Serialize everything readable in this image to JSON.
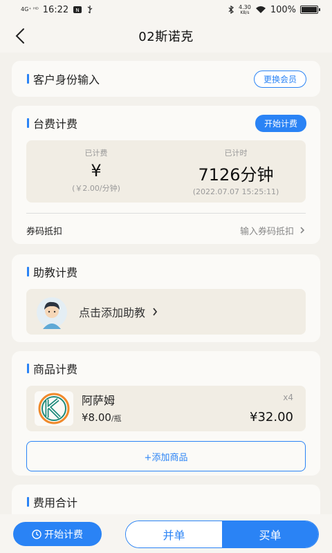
{
  "status_bar": {
    "signal": "4G⁺ ᴴᴰ",
    "time": "16:22",
    "speed_value": "4.30",
    "speed_unit": "KB/s",
    "battery": "100%"
  },
  "nav": {
    "title": "02斯诺克"
  },
  "customer": {
    "title": "客户身份输入",
    "switch_label": "更换会员"
  },
  "table_fee": {
    "title": "台费计费",
    "start_label": "开始计费",
    "charged_label": "已计费",
    "charged_value": "¥",
    "rate": "(￥2.00/分钟)",
    "timed_label": "已计时",
    "timed_value": "7126分钟",
    "start_time": "(2022.07.07 15:25:11)",
    "coupon_label": "券码抵扣",
    "coupon_placeholder": "输入券码抵扣"
  },
  "coach": {
    "title": "助教计费",
    "add_label": "点击添加助教"
  },
  "goods": {
    "title": "商品计费",
    "items": [
      {
        "name": "阿萨姆",
        "price": "¥8.00",
        "unit": "/瓶",
        "qty": "x4",
        "total": "¥32.00"
      }
    ],
    "add_label": "+添加商品"
  },
  "total": {
    "title": "费用合计"
  },
  "bottom": {
    "start_label": "开始计费",
    "merge_label": "并单",
    "buy_label": "买单"
  },
  "colors": {
    "accent": "#2a83f5",
    "background": "#f3f1ec",
    "card": "#fbfaf7",
    "box": "#f1ede4"
  }
}
